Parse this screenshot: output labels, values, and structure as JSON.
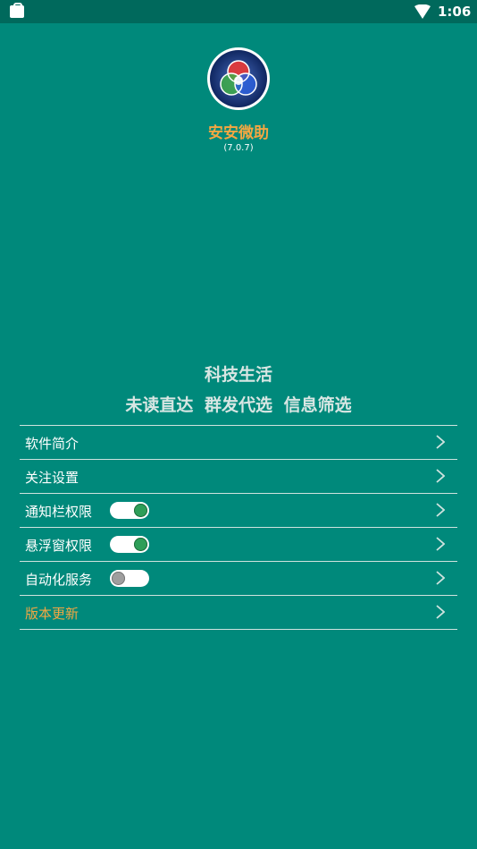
{
  "status_bar": {
    "time": "1:06",
    "left_icon": "shopping-bag-icon",
    "right_icon": "wifi-icon"
  },
  "app": {
    "name": "安安微助",
    "version": "(7.0.7)",
    "logo_icon": "rgb-circles-logo"
  },
  "slogan": {
    "main": "科技生活",
    "sub": "未读直达  群发代选  信息筛选"
  },
  "menu": {
    "items": [
      {
        "label": "软件简介"
      },
      {
        "label": "关注设置"
      },
      {
        "label": "通知栏权限",
        "toggle": "on"
      },
      {
        "label": "悬浮窗权限",
        "toggle": "on"
      },
      {
        "label": "自动化服务",
        "toggle": "off"
      },
      {
        "label": "版本更新"
      }
    ]
  },
  "colors": {
    "background": "#00897B",
    "status_bar": "#00695C",
    "accent": "#F4A742",
    "toggle_on": "#2E9E58",
    "toggle_off": "#9E9E9E"
  }
}
